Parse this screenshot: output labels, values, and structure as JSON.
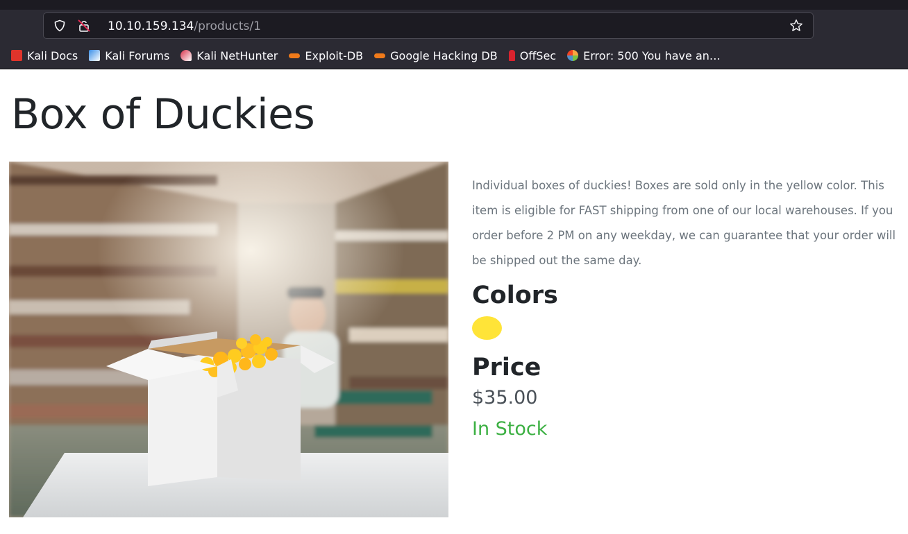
{
  "browser": {
    "url_host": "10.10.159.134",
    "url_path": "/products/1",
    "bookmarks": [
      {
        "label": "Kali Docs",
        "icon": "kali-docs-icon",
        "color": "#e0342b"
      },
      {
        "label": "Kali Forums",
        "icon": "kali-forums-icon",
        "color": "#3a8ee6"
      },
      {
        "label": "Kali NetHunter",
        "icon": "kali-nethunter-icon",
        "color": "#d9304a"
      },
      {
        "label": "Exploit-DB",
        "icon": "exploit-db-icon",
        "color": "#f07a1a"
      },
      {
        "label": "Google Hacking DB",
        "icon": "ghdb-icon",
        "color": "#f07a1a"
      },
      {
        "label": "OffSec",
        "icon": "offsec-icon",
        "color": "#d9232e"
      },
      {
        "label": "Error: 500 You have an…",
        "icon": "joomla-icon",
        "color": "#f9a541"
      }
    ]
  },
  "product": {
    "title": "Box of Duckies",
    "description": "Individual boxes of duckies! Boxes are sold only in the yellow color. This item is eligible for FAST shipping from one of our local warehouses. If you order before 2 PM on any weekday, we can guarantee that your order will be shipped out the same day.",
    "colors_heading": "Colors",
    "colors": [
      "#ffe438"
    ],
    "price_heading": "Price",
    "price": "$35.00",
    "stock_status": "In Stock"
  }
}
